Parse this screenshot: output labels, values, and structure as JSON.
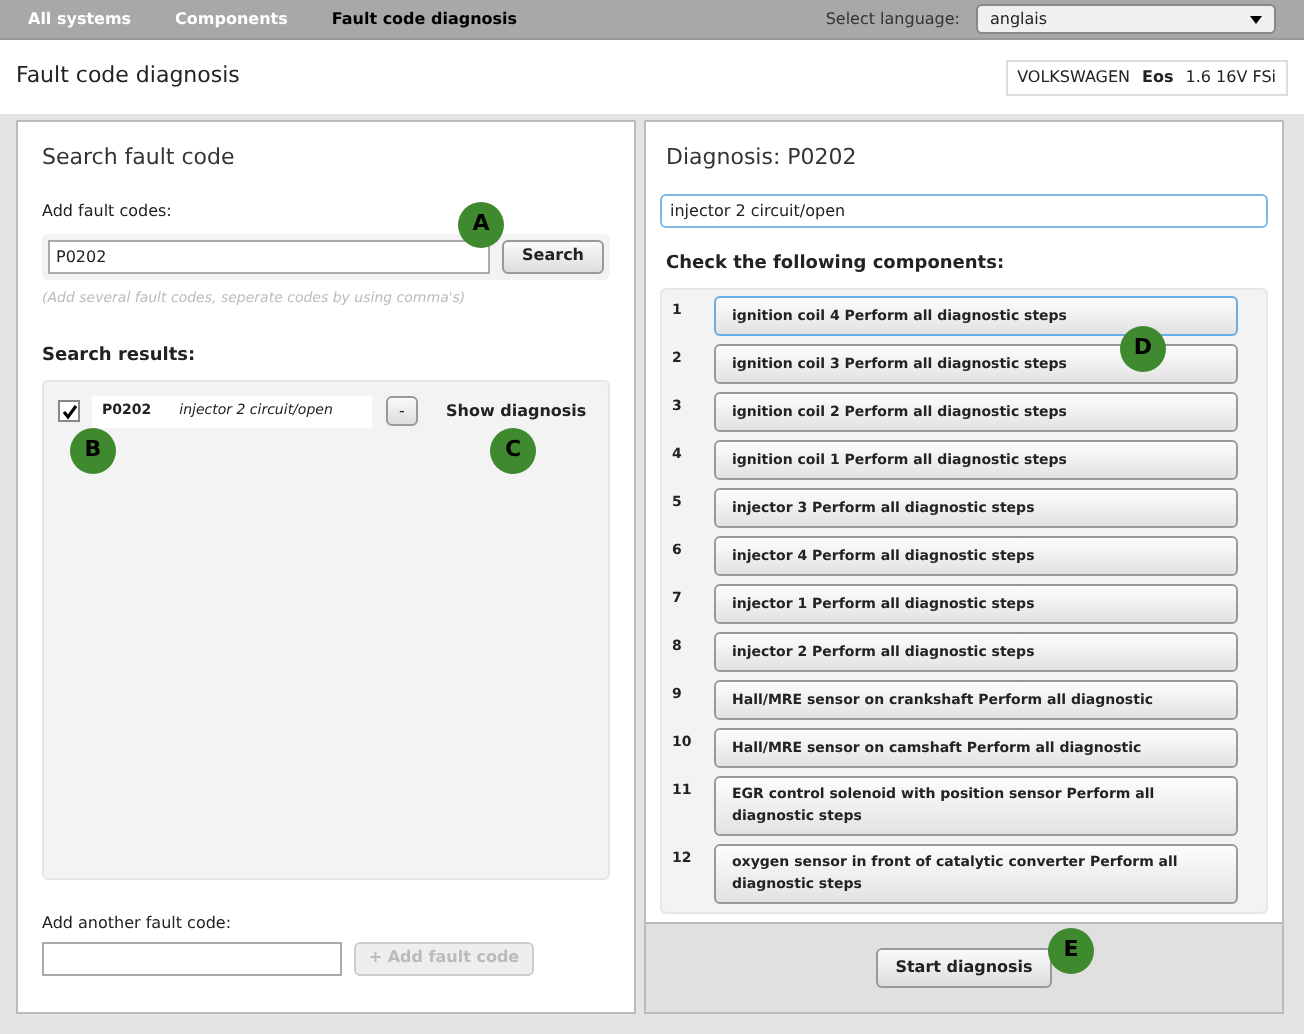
{
  "nav": {
    "items": [
      {
        "label": "All systems",
        "selected": false
      },
      {
        "label": "Components",
        "selected": false
      },
      {
        "label": "Fault code diagnosis",
        "selected": true
      }
    ],
    "language_label": "Select language:",
    "language_value": "anglais"
  },
  "header": {
    "title": "Fault code diagnosis",
    "vehicle": {
      "make": "VOLKSWAGEN",
      "model": "Eos",
      "engine": "1.6 16V FSi"
    }
  },
  "search_panel": {
    "title": "Search fault code",
    "add_label": "Add fault codes:",
    "code_value": "P0202",
    "search_button": "Search",
    "hint": "(Add several fault codes, seperate codes by using comma's)",
    "results_title": "Search results:",
    "results": [
      {
        "checked": true,
        "code": "P0202",
        "description": "injector 2 circuit/open",
        "remove_button": "-",
        "show_link": "Show diagnosis"
      }
    ],
    "add_another_label": "Add another fault code:",
    "add_button": {
      "label": "+ Add fault code",
      "disabled": true
    }
  },
  "diagnosis_panel": {
    "title": "Diagnosis: P0202",
    "description_value": "injector 2 circuit/open",
    "components_title": "Check the following components:",
    "components": [
      {
        "number": "1",
        "label": "ignition coil 4 Perform all diagnostic steps",
        "selected": true
      },
      {
        "number": "2",
        "label": "ignition coil 3 Perform all diagnostic steps",
        "selected": false
      },
      {
        "number": "3",
        "label": "ignition coil 2 Perform all diagnostic steps",
        "selected": false
      },
      {
        "number": "4",
        "label": "ignition coil 1 Perform all diagnostic steps",
        "selected": false
      },
      {
        "number": "5",
        "label": "injector 3 Perform all diagnostic steps",
        "selected": false
      },
      {
        "number": "6",
        "label": "injector 4 Perform all diagnostic steps",
        "selected": false
      },
      {
        "number": "7",
        "label": "injector 1 Perform all diagnostic steps",
        "selected": false
      },
      {
        "number": "8",
        "label": "injector 2 Perform all diagnostic steps",
        "selected": false
      },
      {
        "number": "9",
        "label": "Hall/MRE sensor on crankshaft Perform all diagnostic",
        "selected": false
      },
      {
        "number": "10",
        "label": "Hall/MRE sensor on camshaft Perform all diagnostic",
        "selected": false
      },
      {
        "number": "11",
        "label": "EGR control solenoid with position sensor Perform all diagnostic steps",
        "selected": false
      },
      {
        "number": "12",
        "label": "oxygen sensor in front of catalytic converter Perform all diagnostic steps",
        "selected": false
      }
    ],
    "start_button": "Start diagnosis"
  },
  "callouts": [
    "A",
    "B",
    "C",
    "D",
    "E"
  ]
}
